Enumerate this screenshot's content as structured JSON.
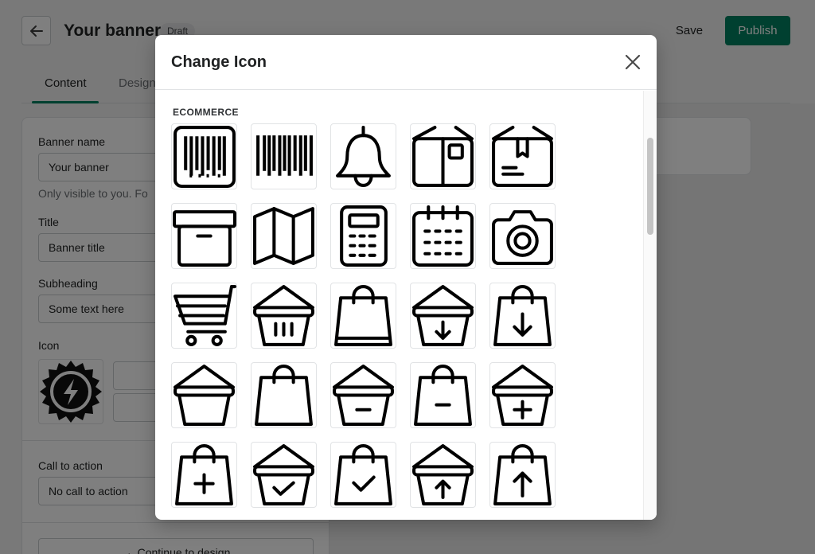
{
  "header": {
    "back_icon": "arrow-left-icon",
    "title": "Your banner",
    "badge": "Draft",
    "save_label": "Save",
    "publish_label": "Publish",
    "publish_color": "#008060"
  },
  "tabs": [
    {
      "label": "Content",
      "active": true
    },
    {
      "label": "Design",
      "active": false
    }
  ],
  "form": {
    "banner_name_label": "Banner name",
    "banner_name_value": "Your banner",
    "banner_name_help": "Only visible to you. Fo",
    "title_label": "Title",
    "title_value": "Banner title",
    "subheading_label": "Subheading",
    "subheading_value": "Some text here",
    "icon_label": "Icon",
    "icon_current": "lightning-badge-icon",
    "cta_label": "Call to action",
    "cta_value": "No call to action",
    "continue_label": "Continue to design"
  },
  "modal": {
    "title": "Change Icon",
    "close_icon": "close-icon",
    "section": "ECOMMERCE",
    "icons": [
      "barcode-boxed-icon",
      "barcode-icon",
      "bell-icon",
      "open-box-icon",
      "package-label-icon",
      "archive-box-icon",
      "map-icon",
      "calculator-icon",
      "calendar-icon",
      "camera-icon",
      "shopping-cart-icon",
      "basket-items-icon",
      "shopping-bag-icon",
      "basket-download-icon",
      "bag-download-icon",
      "basket-icon",
      "bag-icon",
      "basket-minus-icon",
      "bag-minus-icon",
      "basket-plus-icon",
      "bag-plus-icon",
      "basket-check-icon",
      "bag-check-icon",
      "basket-upload-icon",
      "bag-upload-icon"
    ]
  }
}
